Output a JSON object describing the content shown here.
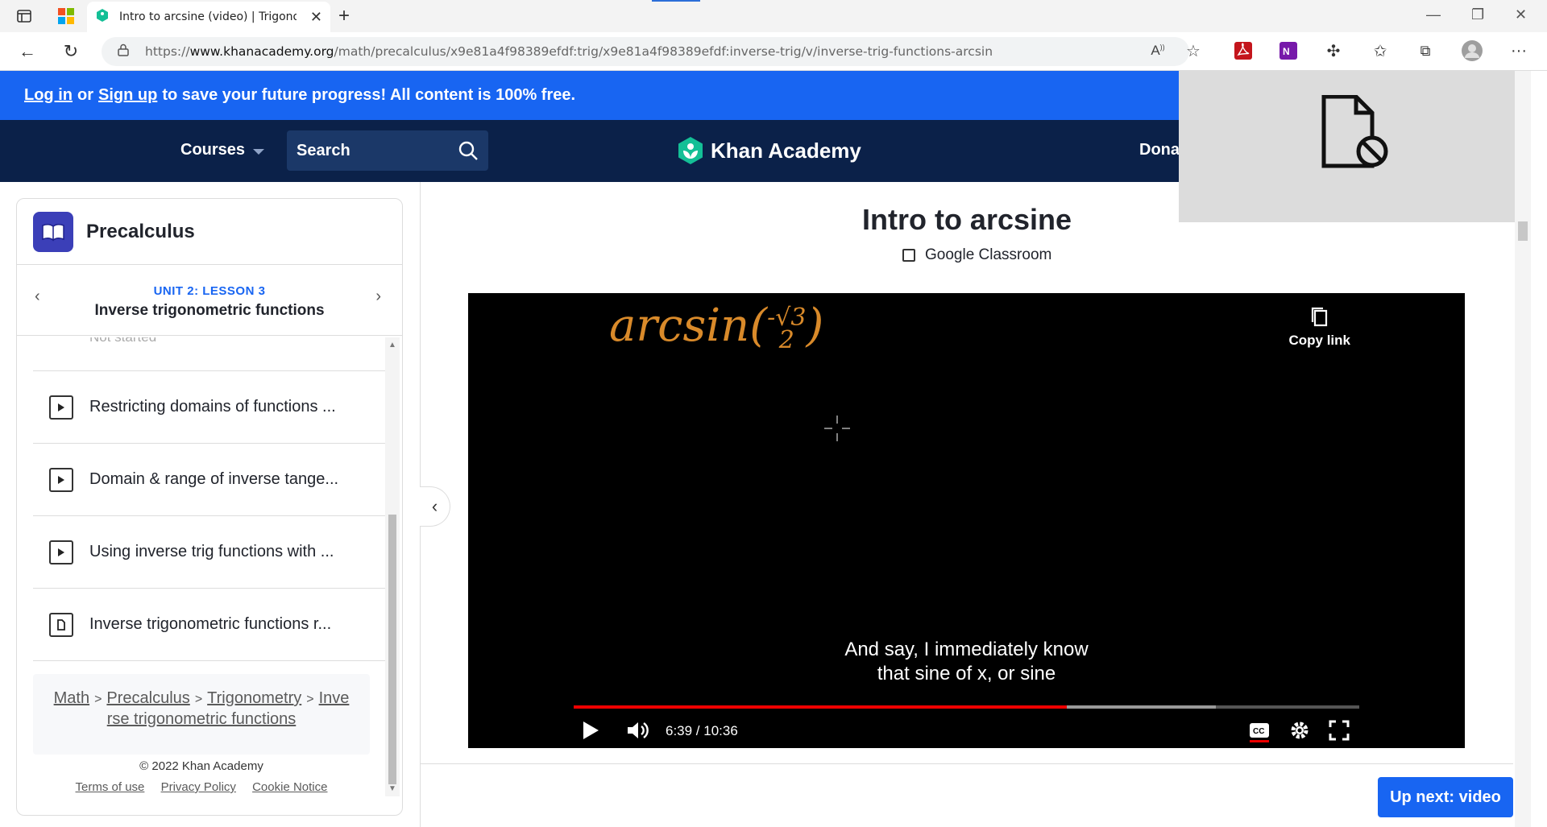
{
  "browser": {
    "tab_title": "Intro to arcsine (video) | Trigonom",
    "url_prefix": "https://",
    "url_domain": "www.khanacademy.org",
    "url_path": "/math/precalculus/x9e81a4f98389efdf:trig/x9e81a4f98389efdf:inverse-trig/v/inverse-trig-functions-arcsin"
  },
  "promo": {
    "login": "Log in",
    "or": "or",
    "signup": "Sign up",
    "message": "to save your future progress! All content is 100% free."
  },
  "header": {
    "courses": "Courses",
    "search_placeholder": "Search",
    "logo": "Khan Academy",
    "donate": "Dona"
  },
  "sidebar": {
    "course": "Precalculus",
    "unit": "UNIT 2: LESSON 3",
    "lesson": "Inverse trigonometric functions",
    "partial_item": "Not started",
    "items": [
      {
        "label": "Restricting domains of functions ...",
        "icon": "play-icon"
      },
      {
        "label": "Domain & range of inverse tange...",
        "icon": "play-icon"
      },
      {
        "label": "Using inverse trig functions with ...",
        "icon": "play-icon"
      },
      {
        "label": "Inverse trigonometric functions r...",
        "icon": "article-icon"
      }
    ],
    "breadcrumbs": [
      "Math",
      "Precalculus",
      "Trigonometry",
      "Inve rse trigonometric functions"
    ],
    "breadcrumb_sep": ">",
    "copyright": "© 2022 Khan Academy",
    "footer_links": [
      "Terms of use",
      "Privacy Policy",
      "Cookie Notice"
    ]
  },
  "main": {
    "title": "Intro to arcsine",
    "classroom": "Google Classroom",
    "video": {
      "board_text": "arcsin",
      "frac_num": "-√3",
      "frac_den": "2",
      "copy_link": "Copy link",
      "caption_line1": "And say, I immediately know",
      "caption_line2": "that sine of x, or sine",
      "time": "6:39 / 10:36",
      "progress_fraction": 0.628,
      "buffered_fraction": 0.817
    },
    "up_next": "Up next: video"
  }
}
